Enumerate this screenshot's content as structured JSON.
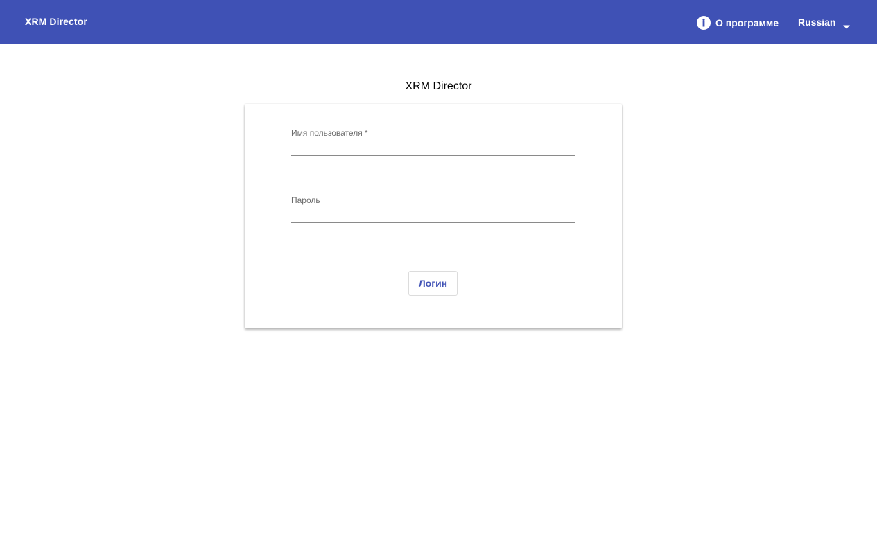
{
  "header": {
    "app_title": "XRM Director",
    "about_label": "О программе",
    "about_icon": "info-icon",
    "language_label": "Russian",
    "language_icon": "caret-down-icon",
    "background_color": "#3f51b5",
    "text_color": "#ffffff"
  },
  "main": {
    "title": "XRM Director"
  },
  "login_form": {
    "username": {
      "label": "Имя пользователя",
      "required_marker": "*",
      "value": ""
    },
    "password": {
      "label": "Пароль",
      "value": ""
    },
    "submit_label": "Логин",
    "accent_color": "#3f51b5"
  }
}
